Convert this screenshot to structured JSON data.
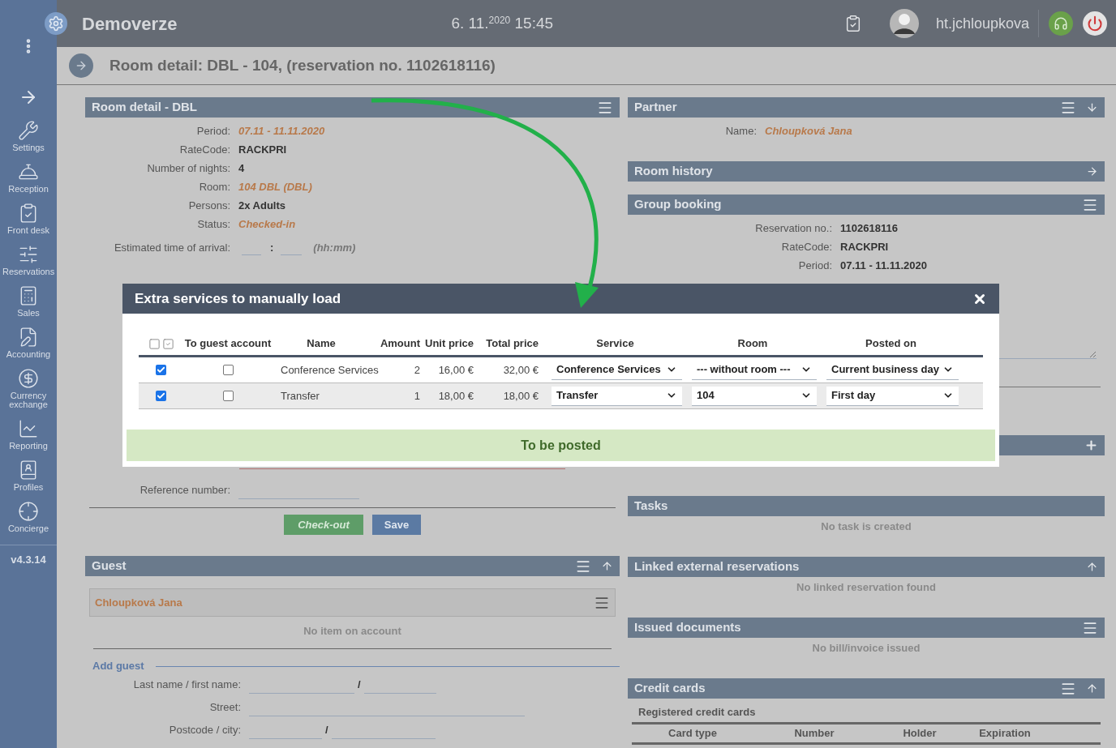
{
  "topbar": {
    "title": "Demoverze",
    "date": "6. 11.",
    "year": "2020",
    "time": "15:45",
    "user": "ht.jchloupkova"
  },
  "sidebar": {
    "items": [
      {
        "label": "Settings",
        "kind": "settings"
      },
      {
        "label": "Reception",
        "kind": "reception"
      },
      {
        "label": "Front desk",
        "kind": "frontdesk"
      },
      {
        "label": "Reservations",
        "kind": "reservations"
      },
      {
        "label": "Sales",
        "kind": "sales"
      },
      {
        "label": "Accounting",
        "kind": "accounting"
      },
      {
        "label": "Currency exchange",
        "kind": "currency"
      },
      {
        "label": "Reporting",
        "kind": "reporting"
      },
      {
        "label": "Profiles",
        "kind": "profiles"
      },
      {
        "label": "Concierge",
        "kind": "concierge"
      }
    ],
    "version": "v4.3.14"
  },
  "page_title": "Room detail: DBL - 104, (reservation no. 1102618116)",
  "room_detail": {
    "title": "Room detail - DBL",
    "fields": [
      {
        "label": "Period:",
        "value": "07.11 - 11.11.2020",
        "kind": "highlight"
      },
      {
        "label": "RateCode:",
        "value": "RACKPRI",
        "kind": "plain"
      },
      {
        "label": "Number of nights:",
        "value": "4",
        "kind": "plain"
      },
      {
        "label": "Room:",
        "value": "104 DBL (DBL)",
        "kind": "highlight"
      },
      {
        "label": "Persons:",
        "value": "2x Adults",
        "kind": "plain"
      },
      {
        "label": "Status:",
        "value": "Checked-in",
        "kind": "highlight"
      }
    ],
    "arrival": {
      "label": "Estimated time of arrival:",
      "separator": ":",
      "hint": "(hh:mm)"
    },
    "reference_label": "Reference number:",
    "buttons": [
      {
        "label": "Check-out",
        "kind": "success"
      },
      {
        "label": "Save",
        "kind": "primary"
      }
    ]
  },
  "guest": {
    "title": "Guest",
    "name": "Chloupková Jana",
    "empty": "No item on account",
    "add_title": "Add guest",
    "form": [
      {
        "label": "Last name / first name:",
        "kind": "pair",
        "separator": "/"
      },
      {
        "label": "Street:",
        "kind": "single"
      },
      {
        "label": "Postcode / city:",
        "kind": "pair",
        "separator": "/"
      }
    ]
  },
  "partner": {
    "title": "Partner",
    "fields": [
      {
        "label": "Name:",
        "value": "Chloupková Jana"
      }
    ]
  },
  "room_history": {
    "title": "Room history"
  },
  "group_booking": {
    "title": "Group booking",
    "fields": [
      {
        "label": "Reservation no.:",
        "value": "1102618116"
      },
      {
        "label": "RateCode:",
        "value": "RACKPRI"
      },
      {
        "label": "Period:",
        "value": "07.11 - 11.11.2020"
      }
    ]
  },
  "tasks": {
    "title": "Tasks",
    "empty": "No task is created"
  },
  "linked": {
    "title": "Linked external reservations",
    "empty": "No linked reservation found"
  },
  "documents": {
    "title": "Issued documents",
    "empty": "No bill/invoice issued"
  },
  "credit_cards": {
    "title": "Credit cards",
    "subtitle": "Registered credit cards",
    "columns": [
      "Card type",
      "Number",
      "Holder",
      "Expiration"
    ]
  },
  "modal": {
    "title": "Extra services to manually load",
    "columns": [
      "To guest account",
      "Name",
      "Amount",
      "Unit price",
      "Total price",
      "Service",
      "Room",
      "Posted on"
    ],
    "rows": [
      {
        "checked": true,
        "to_guest_account": false,
        "name": "Conference Services",
        "amount": "2",
        "unit_price": "16,00 €",
        "total_price": "32,00 €",
        "service": "Conference Services",
        "room": "--- without room ---",
        "posted_on": "Current business day"
      },
      {
        "checked": true,
        "to_guest_account": false,
        "name": "Transfer",
        "amount": "1",
        "unit_price": "18,00 €",
        "total_price": "18,00 €",
        "service": "Transfer",
        "room": "104",
        "posted_on": "First day"
      }
    ],
    "action": "To be posted"
  }
}
